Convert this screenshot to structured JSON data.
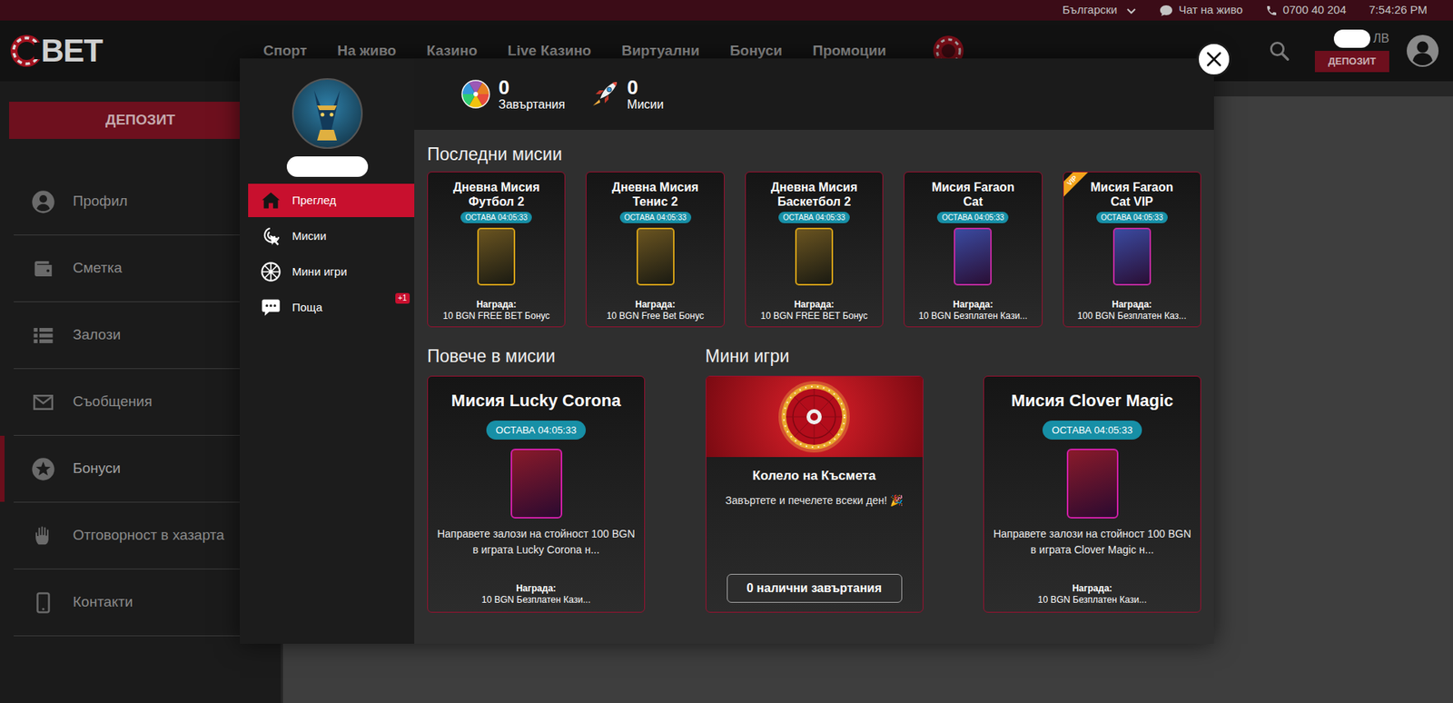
{
  "top_bar": {
    "language": "Български",
    "chat": "Чат на живо",
    "phone": "0700 40 204",
    "time": "7:54:26 PM"
  },
  "header": {
    "logo": "BET",
    "nav": [
      "Спорт",
      "На живо",
      "Казино",
      "Live Казино",
      "Виртуални",
      "Бонуси",
      "Промоции"
    ],
    "currency": "ЛВ",
    "deposit": "ДЕПОЗИТ"
  },
  "sidebar": {
    "deposit": "ДЕПОЗИТ",
    "items": [
      {
        "label": "Профил",
        "selected": false
      },
      {
        "label": "Сметка",
        "selected": false
      },
      {
        "label": "Залози",
        "selected": false
      },
      {
        "label": "Съобщения",
        "selected": false
      },
      {
        "label": "Бонуси",
        "selected": true
      },
      {
        "label": "Отговорност в хазарта",
        "selected": false
      },
      {
        "label": "Контакти",
        "selected": false
      }
    ]
  },
  "modal": {
    "menu": [
      {
        "label": "Преглед",
        "selected": true
      },
      {
        "label": "Мисии",
        "selected": false
      },
      {
        "label": "Мини игри",
        "selected": false
      },
      {
        "label": "Поща",
        "selected": false,
        "badge": "+1"
      }
    ],
    "stats": [
      {
        "value": "0",
        "label": "Завъртания"
      },
      {
        "value": "0",
        "label": "Мисии"
      }
    ],
    "recent_title": "Последни мисии",
    "recent": [
      {
        "kind": "sport",
        "title_lines": [
          "Дневна Мисия",
          "Футбол 2"
        ],
        "timer": "ОСТАВА 04:05:33",
        "reward_label": "Награда:",
        "reward": "10 BGN FREE BET Бонус"
      },
      {
        "kind": "sport",
        "title_lines": [
          "Дневна Мисия",
          "Тенис 2"
        ],
        "timer": "ОСТАВА 04:05:33",
        "reward_label": "Награда:",
        "reward": "10 BGN Free Bet Бонус"
      },
      {
        "kind": "sport",
        "title_lines": [
          "Дневна Мисия",
          "Баскетбол 2"
        ],
        "timer": "ОСТАВА 04:05:33",
        "reward_label": "Награда:",
        "reward": "10 BGN FREE BET Бонус"
      },
      {
        "kind": "slot",
        "title_lines": [
          "Мисия Faraon",
          "Cat"
        ],
        "timer": "ОСТАВА 04:05:33",
        "reward_label": "Награда:",
        "reward": "10 BGN Безплатен Кази..."
      },
      {
        "kind": "slot",
        "title_lines": [
          "Мисия Faraon",
          "Cat VIP"
        ],
        "timer": "ОСТАВА 04:05:33",
        "reward_label": "Награда:",
        "reward": "100 BGN Безплатен Каз...",
        "ribbon": "VIP"
      }
    ],
    "more_title": "Повече в мисии",
    "mini_title": "Мини игри",
    "bottom": [
      {
        "kind": "mission",
        "title": "Мисия Lucky Corona",
        "timer": "ОСТАВА 04:05:33",
        "description": "Направете залози на стойност 100 BGN в играта Lucky Corona н...",
        "reward_label": "Награда:",
        "reward": "10 BGN Безплатен Кази..."
      },
      {
        "kind": "game",
        "title": "Колело на Късмета",
        "description": "Завъртете и печелете всеки ден! 🎉",
        "button": "0 налични завъртания"
      },
      {
        "kind": "mission",
        "title": "Мисия Clover Magic",
        "timer": "ОСТАВА 04:05:33",
        "description": "Направете залози на стойност 100 BGN в играта Clover Magic н...",
        "reward_label": "Награда:",
        "reward": "10 BGN Безплатен Кази..."
      }
    ]
  }
}
